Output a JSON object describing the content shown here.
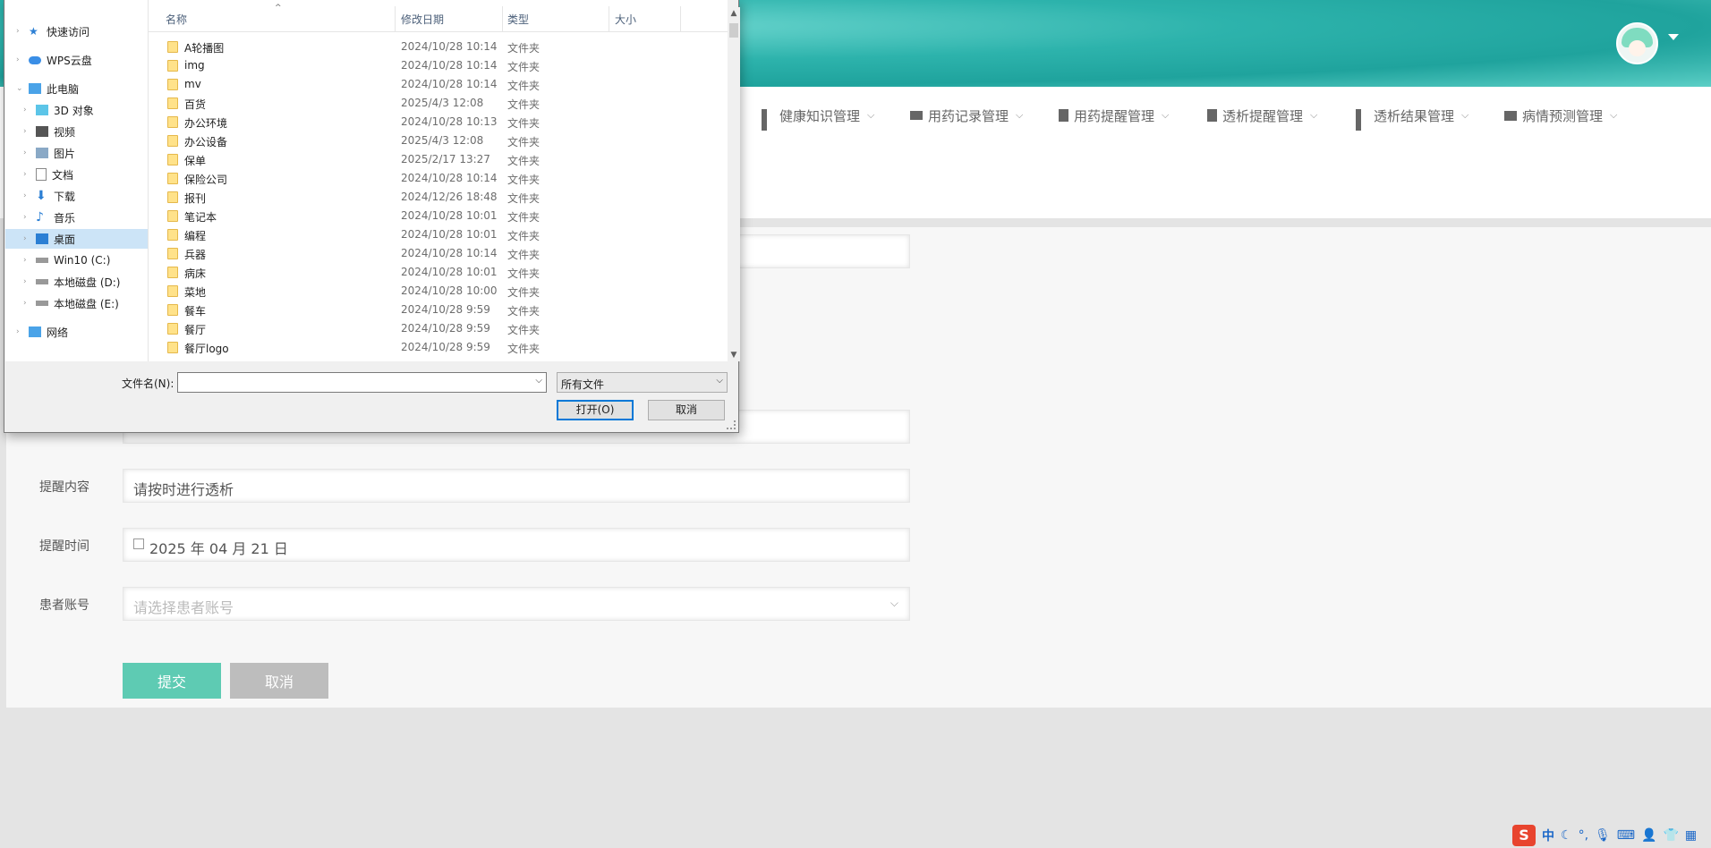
{
  "page": {
    "nav": [
      {
        "label": "健康知识管理",
        "icon": "grid-icon"
      },
      {
        "label": "用药记录管理",
        "icon": "truck-icon"
      },
      {
        "label": "用药提醒管理",
        "icon": "clipboard-icon"
      },
      {
        "label": "透析提醒管理",
        "icon": "clipboard-x-icon"
      },
      {
        "label": "透析结果管理",
        "icon": "grid-icon"
      },
      {
        "label": "病情预测管理",
        "icon": "monitor-icon"
      }
    ],
    "form": {
      "content_label": "提醒内容",
      "content_value": "请按时进行透析",
      "time_label": "提醒时间",
      "time_value": "2025 年 04 月 21 日",
      "patient_label": "患者账号",
      "patient_placeholder": "请选择患者账号",
      "submit_label": "提交",
      "cancel_label": "取消"
    }
  },
  "dialog": {
    "nav_tree": [
      {
        "label": "快速访问",
        "icon": "star-icon"
      },
      {
        "label": "WPS云盘",
        "icon": "cloud-icon"
      },
      {
        "label": "此电脑",
        "icon": "computer-icon"
      },
      {
        "label": "3D 对象",
        "icon": "cube-icon"
      },
      {
        "label": "视频",
        "icon": "video-icon"
      },
      {
        "label": "图片",
        "icon": "picture-icon"
      },
      {
        "label": "文档",
        "icon": "document-icon"
      },
      {
        "label": "下载",
        "icon": "download-icon"
      },
      {
        "label": "音乐",
        "icon": "music-icon"
      },
      {
        "label": "桌面",
        "icon": "desktop-icon"
      },
      {
        "label": "Win10 (C:)",
        "icon": "drive-icon"
      },
      {
        "label": "本地磁盘 (D:)",
        "icon": "drive-icon"
      },
      {
        "label": "本地磁盘 (E:)",
        "icon": "drive-icon"
      },
      {
        "label": "网络",
        "icon": "network-icon"
      }
    ],
    "columns": {
      "name": "名称",
      "modified": "修改日期",
      "type": "类型",
      "size": "大小"
    },
    "files": [
      {
        "name": "A轮播图",
        "date": "2024/10/28 10:14",
        "type": "文件夹"
      },
      {
        "name": "img",
        "date": "2024/10/28 10:14",
        "type": "文件夹"
      },
      {
        "name": "mv",
        "date": "2024/10/28 10:14",
        "type": "文件夹"
      },
      {
        "name": "百货",
        "date": "2025/4/3 12:08",
        "type": "文件夹"
      },
      {
        "name": "办公环境",
        "date": "2024/10/28 10:13",
        "type": "文件夹"
      },
      {
        "name": "办公设备",
        "date": "2025/4/3 12:08",
        "type": "文件夹"
      },
      {
        "name": "保单",
        "date": "2025/2/17 13:27",
        "type": "文件夹"
      },
      {
        "name": "保险公司",
        "date": "2024/10/28 10:14",
        "type": "文件夹"
      },
      {
        "name": "报刊",
        "date": "2024/12/26 18:48",
        "type": "文件夹"
      },
      {
        "name": "笔记本",
        "date": "2024/10/28 10:01",
        "type": "文件夹"
      },
      {
        "name": "编程",
        "date": "2024/10/28 10:01",
        "type": "文件夹"
      },
      {
        "name": "兵器",
        "date": "2024/10/28 10:14",
        "type": "文件夹"
      },
      {
        "name": "病床",
        "date": "2024/10/28 10:01",
        "type": "文件夹"
      },
      {
        "name": "菜地",
        "date": "2024/10/28 10:00",
        "type": "文件夹"
      },
      {
        "name": "餐车",
        "date": "2024/10/28 9:59",
        "type": "文件夹"
      },
      {
        "name": "餐厅",
        "date": "2024/10/28 9:59",
        "type": "文件夹"
      },
      {
        "name": "餐厅logo",
        "date": "2024/10/28 9:59",
        "type": "文件夹"
      }
    ],
    "filename_label": "文件名(N):",
    "filename_value": "",
    "filetype_value": "所有文件",
    "open_label": "打开(O)",
    "cancel_label": "取消"
  },
  "tray": {
    "ime": "中"
  }
}
